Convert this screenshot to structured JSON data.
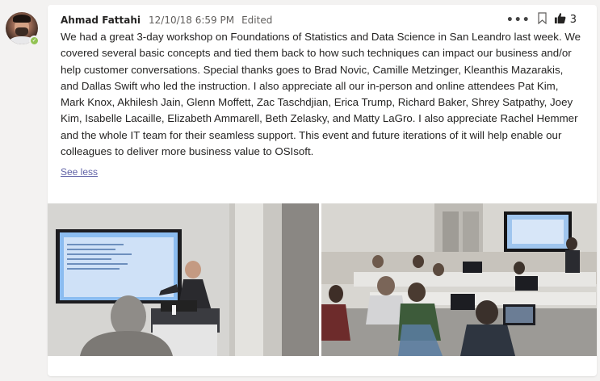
{
  "post": {
    "author": "Ahmad Fattahi",
    "timestamp": "12/10/18 6:59 PM",
    "edited_label": "Edited",
    "like_count": "3",
    "body": "We had a great 3-day workshop on Foundations of Statistics and Data Science in San Leandro last week. We covered several basic concepts and tied them back to how such techniques can impact our business and/or help customer conversations. Special thanks goes to Brad Novic, Camille Metzinger, Kleanthis Mazarakis, and Dallas Swift who led the instruction. I also appreciate all our in-person and online attendees Pat Kim, Mark Knox, Akhilesh Jain, Glenn Moffett, Zac Taschdjian, Erica Trump, Richard Baker, Shrey Satpathy, Joey Kim, Isabelle Lacaille, Elizabeth Ammarell, Beth Zelasky, and Matty LaGro. I also appreciate Rachel Hemmer and the whole IT team for their seamless support. This event and future iterations of it will help enable our colleagues to deliver more business value to OSIsoft.",
    "see_less_label": "See less"
  },
  "icons": {
    "more": "more-options-icon",
    "bookmark": "bookmark-icon",
    "like": "thumbs-up-icon",
    "presence": "presence-available-icon"
  },
  "colors": {
    "accent": "#6264a7",
    "presence": "#92c353",
    "background": "#f3f2f1"
  }
}
